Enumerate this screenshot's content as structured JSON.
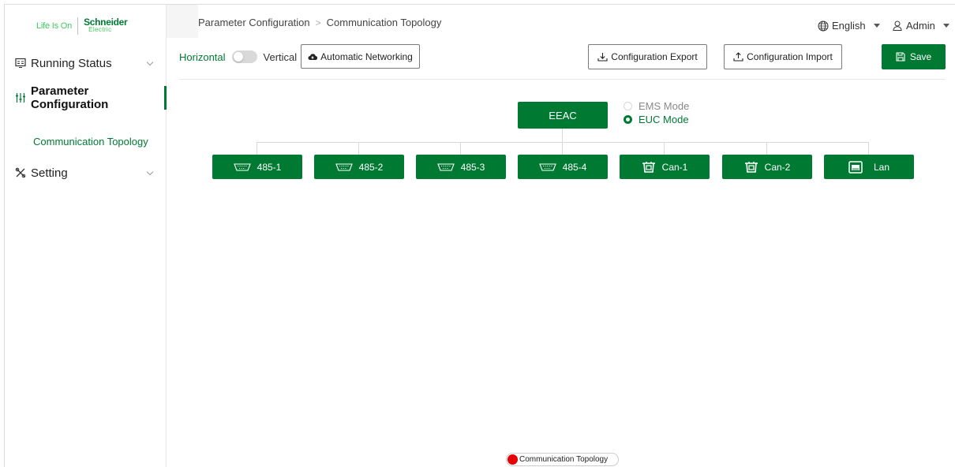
{
  "logo": {
    "tagline": "Life Is On",
    "brand_name": "Schneider",
    "brand_sub": "Electric"
  },
  "sidebar": {
    "items": [
      {
        "label": "Running Status",
        "icon": "monitor-icon"
      },
      {
        "label": "Parameter Configuration",
        "icon": "sliders-icon",
        "active": true
      },
      {
        "label": "Setting",
        "icon": "tools-icon"
      }
    ],
    "sub_item": "Communication Topology"
  },
  "header": {
    "breadcrumb": [
      "Parameter Configuration",
      "Communication Topology"
    ],
    "language": "English",
    "user": "Admin"
  },
  "toolbar": {
    "horizontal_label": "Horizontal",
    "vertical_label": "Vertical",
    "auto_networking": "Automatic Networking",
    "export": "Configuration Export",
    "import": "Configuration Import",
    "save": "Save"
  },
  "topology": {
    "root": "EEAC",
    "modes": [
      {
        "label": "EMS Mode",
        "selected": false
      },
      {
        "label": "EUC Mode",
        "selected": true
      }
    ],
    "ports": [
      {
        "label": "485-1",
        "icon": "serial-port-icon"
      },
      {
        "label": "485-2",
        "icon": "serial-port-icon"
      },
      {
        "label": "485-3",
        "icon": "serial-port-icon"
      },
      {
        "label": "485-4",
        "icon": "serial-port-icon"
      },
      {
        "label": "Can-1",
        "icon": "can-connector-icon"
      },
      {
        "label": "Can-2",
        "icon": "can-connector-icon"
      },
      {
        "label": "Lan",
        "icon": "ethernet-port-icon"
      }
    ]
  },
  "footer_tag": "Communication Topology",
  "colors": {
    "primary": "#007a33",
    "brand_light": "#3dcd58",
    "tag_dot": "#e60000"
  }
}
